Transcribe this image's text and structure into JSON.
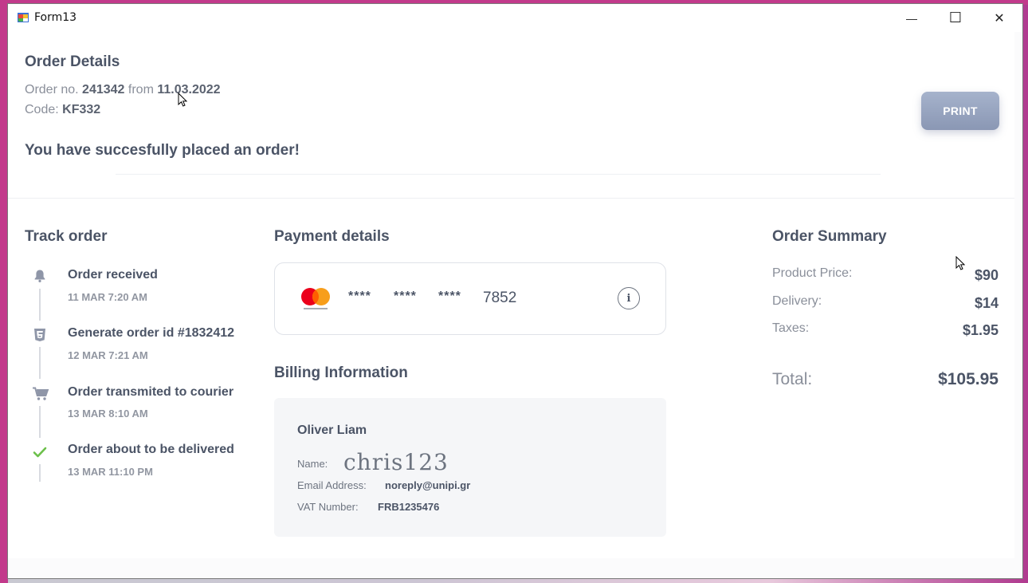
{
  "window": {
    "title": "Form13",
    "minimize_glyph": "—",
    "maximize_glyph": "☐",
    "close_glyph": "✕"
  },
  "order": {
    "heading": "Order Details",
    "order_no_label": "Order no.",
    "order_no": "241342",
    "from_label": "from",
    "date": "11.03.2022",
    "code_label": "Code:",
    "code": "KF332",
    "success_message": "You have succesfully placed an order!",
    "print_label": "PRINT"
  },
  "track": {
    "heading": "Track order",
    "steps": [
      {
        "title": "Order received",
        "time": "11 MAR 7:20 AM",
        "icon": "bell-icon"
      },
      {
        "title": "Generate order id #1832412",
        "time": "12 MAR 7:21 AM",
        "icon": "html5-icon"
      },
      {
        "title": "Order transmited to courier",
        "time": "13 MAR 8:10 AM",
        "icon": "cart-icon"
      },
      {
        "title": "Order about to be delivered",
        "time": "13 MAR 11:10 PM",
        "icon": "check-icon"
      }
    ]
  },
  "payment": {
    "heading": "Payment details",
    "card_mask": [
      "****",
      "****",
      "****"
    ],
    "card_last4": "7852",
    "info_glyph": "i",
    "brand_icon": "mastercard-icon"
  },
  "billing": {
    "heading": "Billing Information",
    "customer_name": "Oliver Liam",
    "name_label": "Name:",
    "name_value": "chris123",
    "email_label": "Email Address:",
    "email_value": "noreply@unipi.gr",
    "vat_label": "VAT Number:",
    "vat_value": "FRB1235476"
  },
  "summary": {
    "heading": "Order Summary",
    "product_price_label": "Product Price:",
    "product_price": "$90",
    "delivery_label": "Delivery:",
    "delivery": "$14",
    "taxes_label": "Taxes:",
    "taxes": "$1.95",
    "total_label": "Total:",
    "total": "$105.95"
  },
  "colors": {
    "heading_text": "#4b5466",
    "muted_text": "#8a8f9a",
    "print_button": "#97a4bf",
    "check_green": "#6cc04a",
    "mastercard_red": "#eb001b",
    "mastercard_orange": "#f79e1b"
  }
}
